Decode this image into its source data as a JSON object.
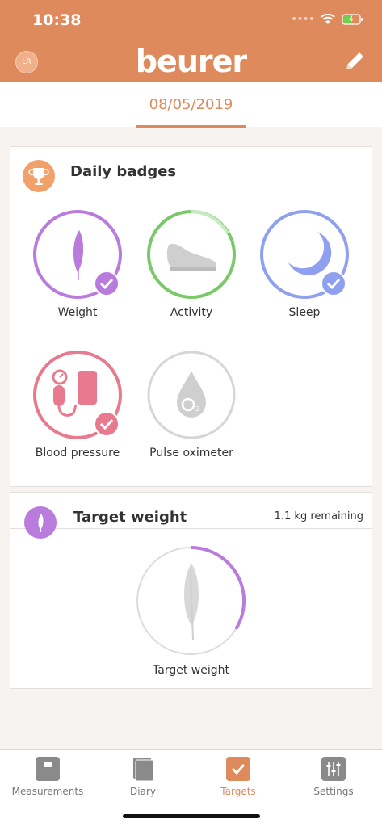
{
  "status_bar": {
    "time": "10:38"
  },
  "header": {
    "avatar_initials": "LR",
    "logo": "beurer"
  },
  "date": "08/05/2019",
  "daily_badges": {
    "title": "Daily badges",
    "items": [
      {
        "label": "Weight",
        "color": "#b97bdc",
        "achieved": true,
        "icon": "feather-icon"
      },
      {
        "label": "Activity",
        "color": "#79c968",
        "achieved": false,
        "progress": 0.25,
        "icon": "shoe-icon"
      },
      {
        "label": "Sleep",
        "color": "#8fa0f0",
        "achieved": true,
        "icon": "moon-icon"
      },
      {
        "label": "Blood pressure",
        "color": "#e87a8f",
        "achieved": true,
        "icon": "blood-pressure-icon"
      },
      {
        "label": "Pulse oximeter",
        "color": "#d0d0d0",
        "achieved": false,
        "icon": "oxygen-drop-icon"
      }
    ]
  },
  "target_weight": {
    "title": "Target weight",
    "remaining": "1.1 kg remaining",
    "label": "Target weight",
    "progress": 0.3,
    "color": "#b97bdc"
  },
  "tabs": [
    {
      "label": "Measurements",
      "icon": "scale-icon",
      "active": false
    },
    {
      "label": "Diary",
      "icon": "book-icon",
      "active": false
    },
    {
      "label": "Targets",
      "icon": "check-icon",
      "active": true
    },
    {
      "label": "Settings",
      "icon": "sliders-icon",
      "active": false
    }
  ],
  "colors": {
    "brand": "#de8a5c",
    "inactive_tab": "#8a8a8a"
  }
}
